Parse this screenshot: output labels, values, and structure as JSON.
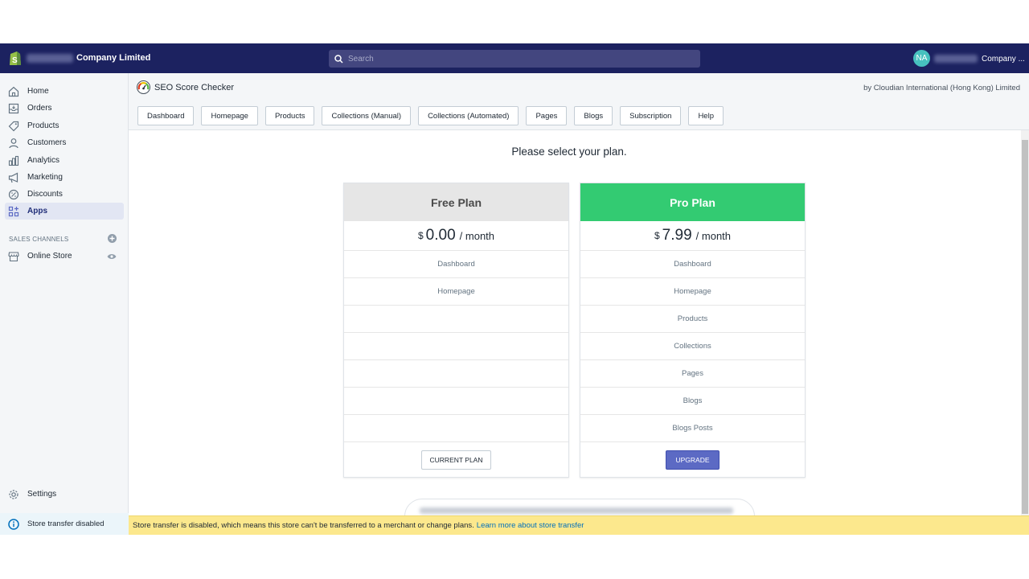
{
  "topbar": {
    "store_name": "Company Limited",
    "search_placeholder": "Search",
    "avatar_initials": "NA",
    "user_name": "Company ..."
  },
  "sidebar": {
    "items": [
      {
        "label": "Home",
        "icon": "home-icon"
      },
      {
        "label": "Orders",
        "icon": "orders-icon"
      },
      {
        "label": "Products",
        "icon": "tag-icon"
      },
      {
        "label": "Customers",
        "icon": "person-icon"
      },
      {
        "label": "Analytics",
        "icon": "bar-chart-icon"
      },
      {
        "label": "Marketing",
        "icon": "megaphone-icon"
      },
      {
        "label": "Discounts",
        "icon": "discount-icon"
      },
      {
        "label": "Apps",
        "icon": "apps-icon",
        "active": true
      }
    ],
    "sales_channels_title": "SALES CHANNELS",
    "online_store": "Online Store",
    "settings": "Settings",
    "store_transfer": "Store transfer disabled"
  },
  "app": {
    "title": "SEO Score Checker",
    "by": "by Cloudian International (Hong Kong) Limited",
    "tabs": [
      "Dashboard",
      "Homepage",
      "Products",
      "Collections (Manual)",
      "Collections (Automated)",
      "Pages",
      "Blogs",
      "Subscription",
      "Help"
    ]
  },
  "plans": {
    "heading": "Please select your plan.",
    "free": {
      "name": "Free Plan",
      "currency": "$",
      "amount": "0.00",
      "per": "/ month",
      "features": [
        "Dashboard",
        "Homepage",
        "",
        "",
        "",
        "",
        ""
      ],
      "button": "CURRENT PLAN"
    },
    "pro": {
      "name": "Pro Plan",
      "currency": "$",
      "amount": "7.99",
      "per": "/ month",
      "features": [
        "Dashboard",
        "Homepage",
        "Products",
        "Collections",
        "Pages",
        "Blogs",
        "Blogs Posts"
      ],
      "button": "UPGRADE"
    }
  },
  "banner": {
    "text": "Store transfer is disabled, which means this store can't be transferred to a merchant or change plans.",
    "link": "Learn more about store transfer"
  },
  "colors": {
    "topbar": "#1c2260",
    "pro_accent": "#33cb72",
    "upgrade_button": "#5c6ac4",
    "banner": "#fce88d"
  }
}
